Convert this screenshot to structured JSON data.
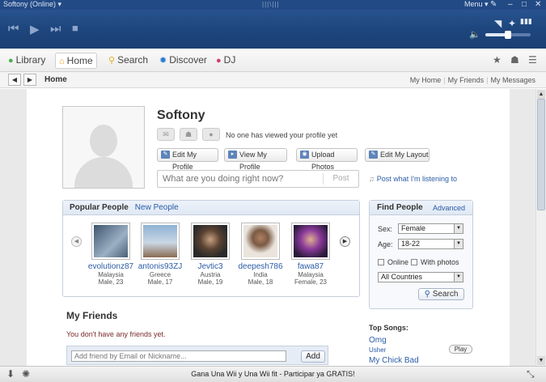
{
  "window": {
    "title": "Softony (Online) ▾",
    "logo": "|||\\|||",
    "menu": "Menu ▾",
    "minimize": "–",
    "restore": "□",
    "close": "✕"
  },
  "player": {
    "prev": "⏮",
    "play": "▶",
    "next": "⏭",
    "stop": "■",
    "mute": "🔈",
    "cast": "◥",
    "levels": "▮▮▮",
    "volume_level": 0.5
  },
  "nav": {
    "items": [
      {
        "label": "Library",
        "icon": "●"
      },
      {
        "label": "Home",
        "icon": "⌂"
      },
      {
        "label": "Search",
        "icon": "⚲"
      },
      {
        "label": "Discover",
        "icon": "✹"
      },
      {
        "label": "DJ",
        "icon": "●"
      }
    ],
    "star": "★",
    "people": "☗",
    "list": "☰"
  },
  "crumb": {
    "back": "◀",
    "forward": "▶",
    "title": "Home",
    "links": [
      "My Home",
      "My Friends",
      "My Messages"
    ]
  },
  "profile": {
    "name": "Softony",
    "views": "No one has viewed your profile yet",
    "mail_icon": "✉",
    "person_icon": "☗",
    "chat_icon": "●",
    "actions": [
      "Edit My Profile",
      "View My Profile",
      "Upload Photos",
      "Edit My Layout"
    ],
    "status_placeholder": "What are you doing right now?",
    "post": "Post",
    "post_note": "Post what I'm listening to",
    "note_icon": "♫"
  },
  "popular": {
    "tab_active": "Popular People",
    "tab_other": "New People",
    "prev": "◀",
    "next": "▶",
    "people": [
      {
        "name": "evolutionz87",
        "country": "Malaysia",
        "info": "Male, 23",
        "color": "#6f8aa6"
      },
      {
        "name": "antonis93ZJ",
        "country": "Greece",
        "info": "Male, 17",
        "color": "#9bb6cf"
      },
      {
        "name": "Jevtic3",
        "country": "Austria",
        "info": "Male, 19",
        "color": "#6b5a4a"
      },
      {
        "name": "deepesh786",
        "country": "India",
        "info": "Male, 18",
        "color": "#c9b8a8"
      },
      {
        "name": "fawa87",
        "country": "Malaysia",
        "info": "Female, 23",
        "color": "#7a3f8a"
      }
    ]
  },
  "find": {
    "title": "Find People",
    "advanced": "Advanced",
    "sex_label": "Sex:",
    "sex": "Female",
    "age_label": "Age:",
    "age": "18-22",
    "online": "Online",
    "photos": "With photos",
    "country": "All Countries",
    "search": "Search",
    "search_icon": "⚲",
    "dd": "▼"
  },
  "friends": {
    "title": "My Friends",
    "empty": "You don't have any friends yet.",
    "add_placeholder": "Add friend by Email or Nickname...",
    "add": "Add"
  },
  "top_songs": {
    "title": "Top Songs:",
    "songs": [
      {
        "title": "Omg",
        "artist": "Usher"
      },
      {
        "title": "My Chick Bad",
        "artist": ""
      }
    ],
    "play": "Play"
  },
  "bottom": {
    "message": "Gana Una Wii y Una Wii fit - Participar ya GRATIS!",
    "download_icon": "⬇",
    "shake_icon": "✺",
    "resize_icon": "⤡"
  },
  "scroll": {
    "up": "▲",
    "down": "▼"
  }
}
